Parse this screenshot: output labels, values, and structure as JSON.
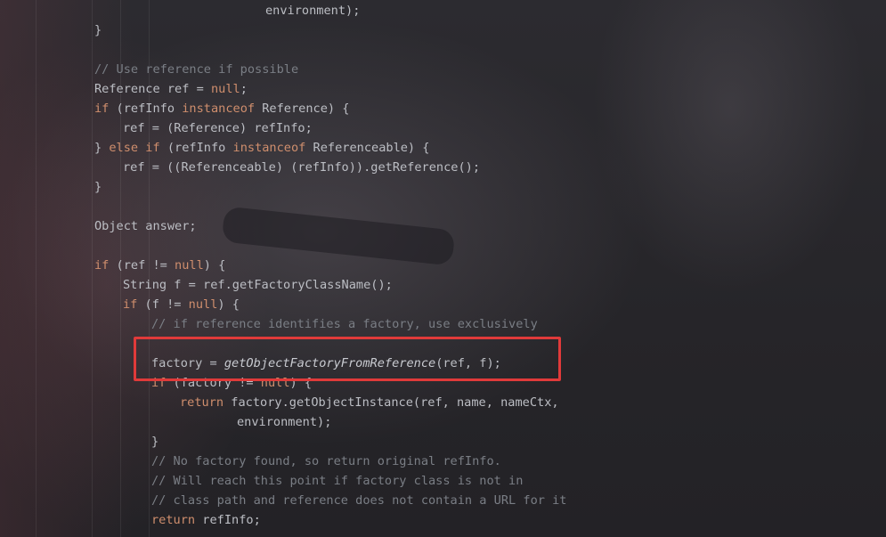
{
  "editor": {
    "lines": [
      {
        "indent": 6,
        "tokens": [
          {
            "t": "environment);",
            "c": "plain"
          }
        ]
      },
      {
        "indent": 0,
        "tokens": [
          {
            "t": "}",
            "c": "plain"
          }
        ]
      },
      {
        "indent": 0,
        "tokens": []
      },
      {
        "indent": 0,
        "tokens": [
          {
            "t": "// Use reference if possible",
            "c": "cmt"
          }
        ]
      },
      {
        "indent": 0,
        "tokens": [
          {
            "t": "Reference ref = ",
            "c": "plain"
          },
          {
            "t": "null",
            "c": "kw"
          },
          {
            "t": ";",
            "c": "plain"
          }
        ]
      },
      {
        "indent": 0,
        "tokens": [
          {
            "t": "if",
            "c": "kw"
          },
          {
            "t": " (refInfo ",
            "c": "plain"
          },
          {
            "t": "instanceof",
            "c": "kw"
          },
          {
            "t": " Reference) {",
            "c": "plain"
          }
        ]
      },
      {
        "indent": 1,
        "tokens": [
          {
            "t": "ref = (Reference) refInfo;",
            "c": "plain"
          }
        ]
      },
      {
        "indent": 0,
        "tokens": [
          {
            "t": "} ",
            "c": "plain"
          },
          {
            "t": "else if",
            "c": "kw"
          },
          {
            "t": " (refInfo ",
            "c": "plain"
          },
          {
            "t": "instanceof",
            "c": "kw"
          },
          {
            "t": " Referenceable) {",
            "c": "plain"
          }
        ]
      },
      {
        "indent": 1,
        "tokens": [
          {
            "t": "ref = ((Referenceable) (refInfo)).getReference();",
            "c": "plain"
          }
        ]
      },
      {
        "indent": 0,
        "tokens": [
          {
            "t": "}",
            "c": "plain"
          }
        ]
      },
      {
        "indent": 0,
        "tokens": []
      },
      {
        "indent": 0,
        "tokens": [
          {
            "t": "Object answer;",
            "c": "plain"
          }
        ]
      },
      {
        "indent": 0,
        "tokens": []
      },
      {
        "indent": 0,
        "tokens": [
          {
            "t": "if",
            "c": "kw"
          },
          {
            "t": " (ref != ",
            "c": "plain"
          },
          {
            "t": "null",
            "c": "kw"
          },
          {
            "t": ") {",
            "c": "plain"
          }
        ]
      },
      {
        "indent": 1,
        "tokens": [
          {
            "t": "String f = ref.getFactoryClassName();",
            "c": "plain"
          }
        ]
      },
      {
        "indent": 1,
        "tokens": [
          {
            "t": "if",
            "c": "kw"
          },
          {
            "t": " (f != ",
            "c": "plain"
          },
          {
            "t": "null",
            "c": "kw"
          },
          {
            "t": ") {",
            "c": "plain"
          }
        ]
      },
      {
        "indent": 2,
        "tokens": [
          {
            "t": "// if reference identifies a factory, use exclusively",
            "c": "cmt"
          }
        ]
      },
      {
        "indent": 0,
        "tokens": []
      },
      {
        "indent": 2,
        "tokens": [
          {
            "t": "factory = ",
            "c": "plain"
          },
          {
            "t": "getObjectFactoryFromReference",
            "c": "fn"
          },
          {
            "t": "(ref, f);",
            "c": "plain"
          }
        ]
      },
      {
        "indent": 2,
        "tokens": [
          {
            "t": "if",
            "c": "kw"
          },
          {
            "t": " (factory != ",
            "c": "plain"
          },
          {
            "t": "null",
            "c": "kw"
          },
          {
            "t": ") {",
            "c": "plain"
          }
        ]
      },
      {
        "indent": 3,
        "tokens": [
          {
            "t": "return",
            "c": "kw"
          },
          {
            "t": " factory.getObjectInstance(ref, name, nameCtx,",
            "c": "plain"
          }
        ]
      },
      {
        "indent": 5,
        "tokens": [
          {
            "t": "environment);",
            "c": "plain"
          }
        ]
      },
      {
        "indent": 2,
        "tokens": [
          {
            "t": "}",
            "c": "plain"
          }
        ]
      },
      {
        "indent": 2,
        "tokens": [
          {
            "t": "// No factory found, so return original refInfo.",
            "c": "cmt"
          }
        ]
      },
      {
        "indent": 2,
        "tokens": [
          {
            "t": "// Will reach this point if factory class is not in",
            "c": "cmt"
          }
        ]
      },
      {
        "indent": 2,
        "tokens": [
          {
            "t": "// class path and reference does not contain a URL for it",
            "c": "cmt"
          }
        ]
      },
      {
        "indent": 2,
        "tokens": [
          {
            "t": "return",
            "c": "kw"
          },
          {
            "t": " refInfo;",
            "c": "plain"
          }
        ]
      }
    ]
  },
  "colors": {
    "keyword": "#cf8e6d",
    "comment": "#7a7e85",
    "text": "#bcbec4",
    "highlight_border": "#e03a3a"
  }
}
